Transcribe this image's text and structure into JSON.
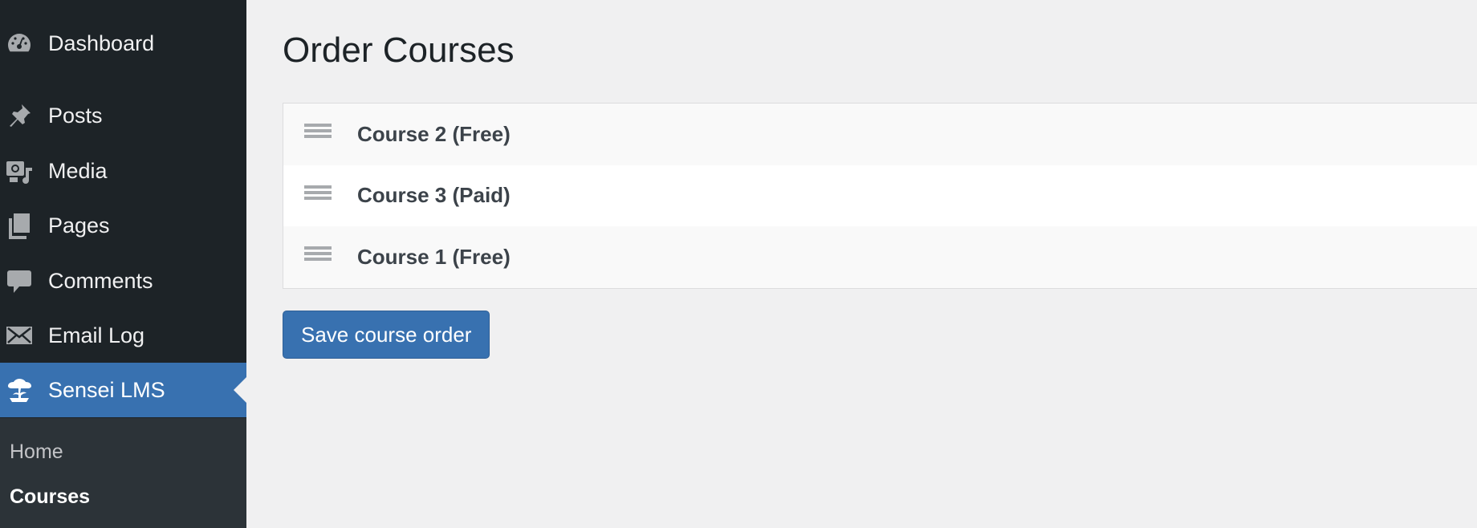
{
  "sidebar": {
    "items": [
      {
        "label": "Dashboard",
        "icon": "dashboard-icon"
      },
      {
        "label": "Posts",
        "icon": "pin-icon"
      },
      {
        "label": "Media",
        "icon": "media-icon"
      },
      {
        "label": "Pages",
        "icon": "pages-icon"
      },
      {
        "label": "Comments",
        "icon": "comment-icon"
      },
      {
        "label": "Email Log",
        "icon": "envelope-icon"
      },
      {
        "label": "Sensei LMS",
        "icon": "bonsai-icon",
        "active": true
      }
    ],
    "submenu": [
      {
        "label": "Home"
      },
      {
        "label": "Courses",
        "current": true
      }
    ]
  },
  "main": {
    "title": "Order Courses",
    "courses": [
      {
        "name": "Course 2 (Free)"
      },
      {
        "name": "Course 3 (Paid)"
      },
      {
        "name": "Course 1 (Free)"
      }
    ],
    "save_label": "Save course order"
  },
  "colors": {
    "sidebar_bg": "#1d2327",
    "submenu_bg": "#2c3338",
    "accent": "#3871b0",
    "page_bg": "#f0f0f1"
  }
}
